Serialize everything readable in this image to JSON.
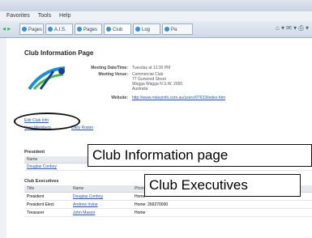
{
  "browser": {
    "menu": [
      "Favorites",
      "Tools",
      "Help"
    ],
    "tabs": [
      "Pages",
      "A.I.S.",
      "Pages",
      "Club",
      "Log",
      "Pa"
    ]
  },
  "page": {
    "title": "Club Information Page",
    "meeting_datetime_label": "Meeting Date/Time:",
    "meeting_datetime": "Tuesday at 12:30 PM",
    "meeting_venue_label": "Meeting Venue:",
    "venue_lines": [
      "Commercial Club",
      "77 Gurwood Street",
      "Wagga Wagga N.S.W. 2650",
      "Australia"
    ],
    "website_label": "Website:",
    "website": "http://www.rotaryinfo.com.au/users/97633/index.htm",
    "edit_club_info": "Edit Club Info",
    "view_members": "View Members",
    "daily_roster": "Daily Roster",
    "president_heading": "President",
    "president_col_name": "Name",
    "president_name": "Douglas Conboy",
    "executives_heading": "Club Executives",
    "exec_columns": [
      "Title",
      "Name",
      "Phone"
    ],
    "executives": [
      {
        "title": "President",
        "name": "Douglas Conboy",
        "phone": "Home"
      },
      {
        "title": "President Elect",
        "name": "Andrew Irvine",
        "phone": "Home: 269270000"
      },
      {
        "title": "Treasurer",
        "name": "John Mason",
        "phone": "Home"
      }
    ]
  },
  "callouts": {
    "info_page": "Club Information page",
    "executives": "Club Executives"
  }
}
